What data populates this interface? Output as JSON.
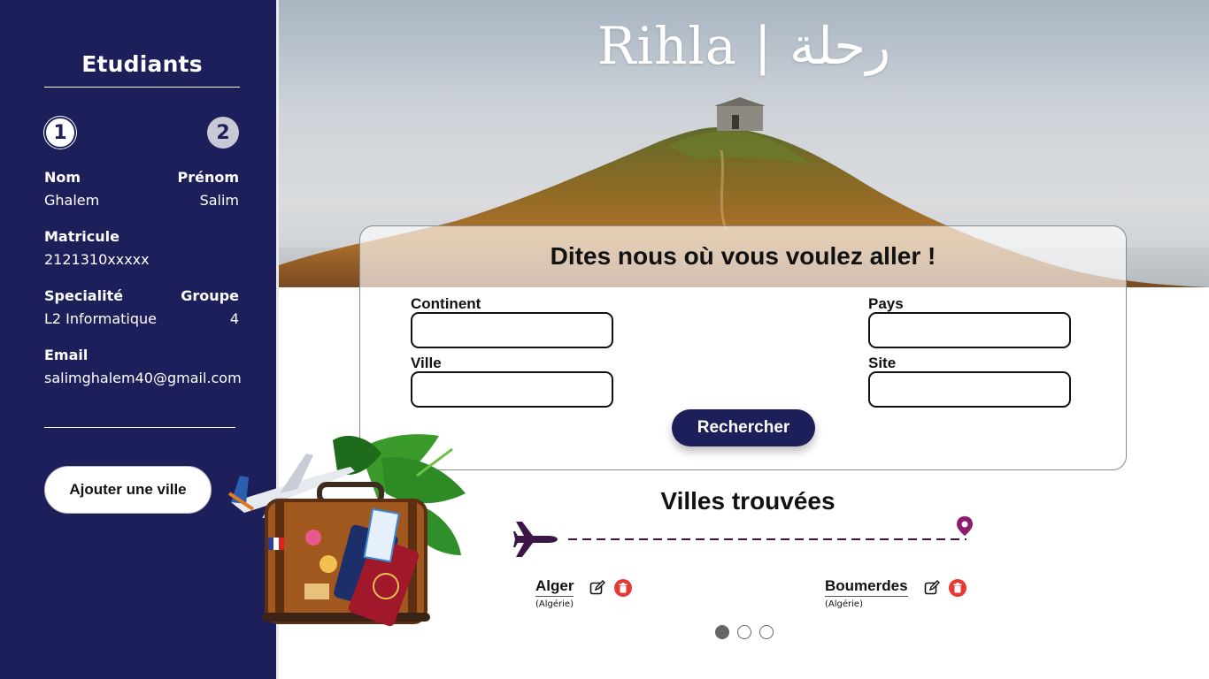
{
  "sidebar": {
    "title": "Etudiants",
    "steps": [
      "1",
      "2"
    ],
    "fields": {
      "nom_label": "Nom",
      "nom_value": "Ghalem",
      "prenom_label": "Prénom",
      "prenom_value": "Salim",
      "matricule_label": "Matricule",
      "matricule_value": "2121310xxxxx",
      "specialite_label": "Specialité",
      "specialite_value": "L2 Informatique",
      "groupe_label": "Groupe",
      "groupe_value": "4",
      "email_label": "Email",
      "email_value": "salimghalem40@gmail.com"
    },
    "add_city_label": "Ajouter une ville"
  },
  "hero": {
    "title": "Rihla | رحلة"
  },
  "search": {
    "title": "Dites nous où vous voulez aller !",
    "continent_label": "Continent",
    "continent_value": "",
    "pays_label": "Pays",
    "pays_value": "",
    "ville_label": "Ville",
    "ville_value": "",
    "site_label": "Site",
    "site_value": "",
    "button_label": "Rechercher"
  },
  "results": {
    "title": "Villes trouvées",
    "cities": [
      {
        "name": "Alger",
        "country": "(Algérie)"
      },
      {
        "name": "Boumerdes",
        "country": "(Algérie)"
      }
    ],
    "pagination": {
      "pages": 3,
      "current": 1
    }
  },
  "colors": {
    "sidebar_bg": "#1d1f5a",
    "button_bg": "#1d1f5a",
    "route_color": "#3d1648",
    "pin_color": "#8e1b6f",
    "delete_color": "#e53935"
  },
  "icons": {
    "plane": "airplane-icon",
    "pin": "location-pin-icon",
    "edit": "edit-icon",
    "delete": "trash-icon"
  }
}
